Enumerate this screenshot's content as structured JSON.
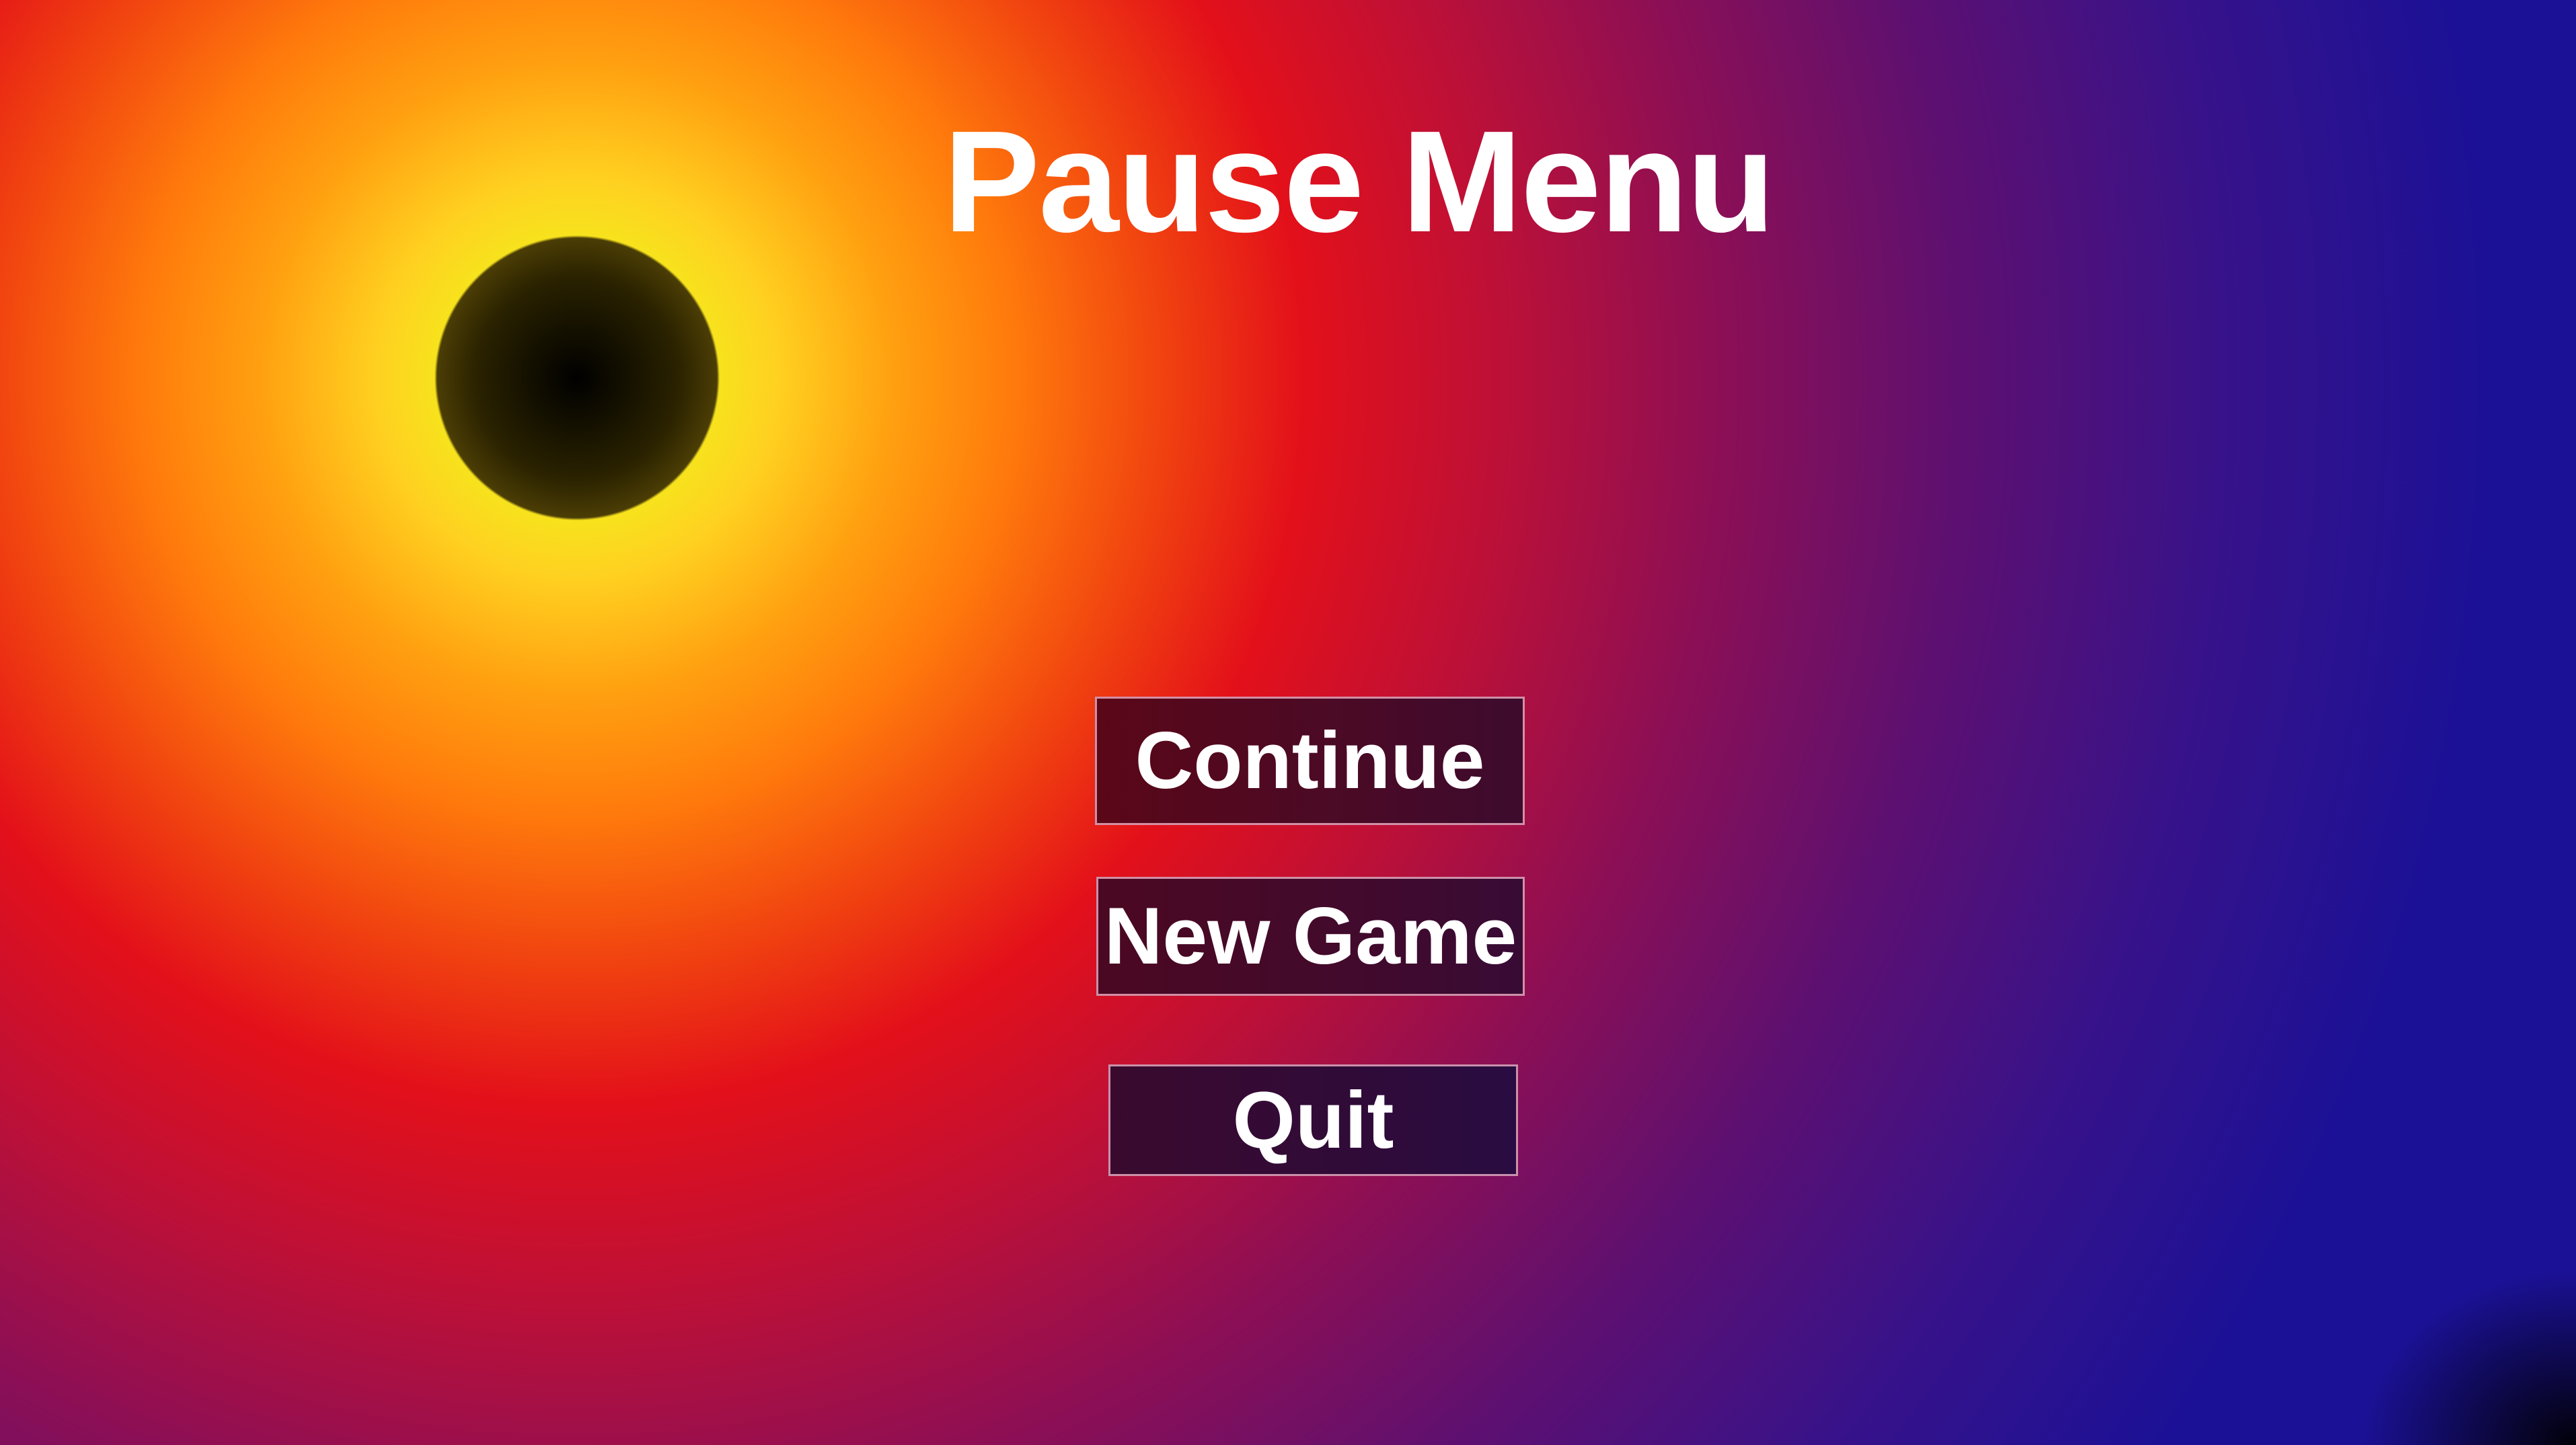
{
  "pause_menu": {
    "title": "Pause Menu",
    "buttons": {
      "continue_label": "Continue",
      "new_game_label": "New Game",
      "quit_label": "Quit"
    }
  },
  "colors": {
    "title_text": "#ffffff",
    "button_text": "#ffffff",
    "button_border": "#ffbed2",
    "background_warm_core": "#ffd020",
    "background_red": "#e3101a",
    "background_blue": "#1b1196",
    "eclipse_core": "#000000"
  }
}
